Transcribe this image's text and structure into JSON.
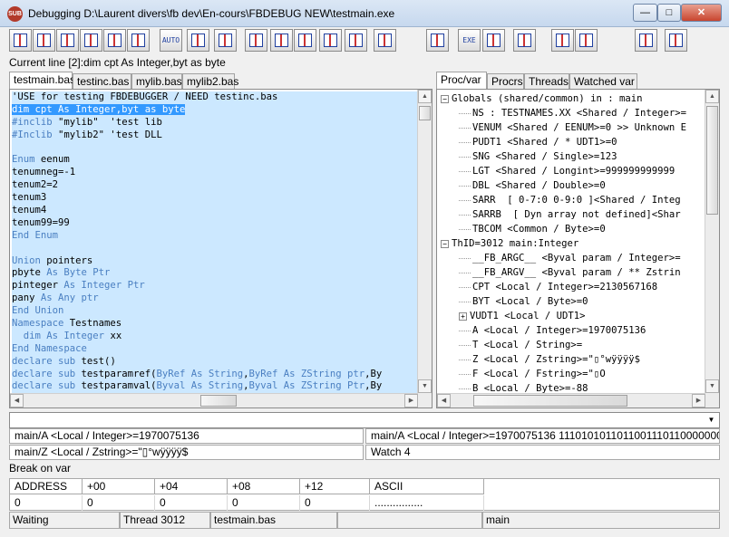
{
  "window": {
    "app_icon_text": "SUB",
    "title": "Debugging D:\\Laurent divers\\fb dev\\En-cours\\FBDEBUG NEW\\testmain.exe",
    "minimize": "—",
    "maximize": "□",
    "close": "✕"
  },
  "toolbar": {
    "buttons": [
      "step",
      "step-over",
      "step-out",
      "run-to-cursor",
      "fast-run",
      "run",
      "auto",
      "run-end",
      "stop-end",
      "kill",
      "breakpoint",
      "breakpoint-temp",
      "skip",
      "show-line",
      "stop",
      "exe-mod",
      "exe",
      "memory",
      "proc",
      "tools",
      "list-a",
      "list-b",
      "list-c"
    ],
    "auto_label": "AUTO",
    "exe_label": "EXE"
  },
  "current_line": "Current line [2]:dim cpt As Integer,byt as byte",
  "source_tabs": [
    "testmain.bas",
    "testinc.bas",
    "mylib.bas",
    "mylib2.bas"
  ],
  "code_lines": [
    [
      {
        "t": "'USE for testing FBDEBUGGER / NEED testinc.bas",
        "c": "n"
      }
    ],
    [
      {
        "t": "dim cpt As Integer,byt as byte",
        "c": "sel"
      }
    ],
    [
      {
        "t": "#inclib",
        "c": "pp"
      },
      {
        "t": " \"mylib\"  'test lib",
        "c": "n"
      }
    ],
    [
      {
        "t": "#Inclib",
        "c": "pp"
      },
      {
        "t": " \"mylib2\" 'test DLL",
        "c": "n"
      }
    ],
    [
      {
        "t": "",
        "c": "n"
      }
    ],
    [
      {
        "t": "Enum",
        "c": "kw"
      },
      {
        "t": " eenum",
        "c": "n"
      }
    ],
    [
      {
        "t": "tenumneg=-1",
        "c": "n"
      }
    ],
    [
      {
        "t": "tenum2=2",
        "c": "n"
      }
    ],
    [
      {
        "t": "tenum3",
        "c": "n"
      }
    ],
    [
      {
        "t": "tenum4",
        "c": "n"
      }
    ],
    [
      {
        "t": "tenum99=99",
        "c": "n"
      }
    ],
    [
      {
        "t": "End Enum",
        "c": "kw"
      }
    ],
    [
      {
        "t": "",
        "c": "n"
      }
    ],
    [
      {
        "t": "Union",
        "c": "kw"
      },
      {
        "t": " pointers",
        "c": "n"
      }
    ],
    [
      {
        "t": "pbyte ",
        "c": "n"
      },
      {
        "t": "As Byte Ptr",
        "c": "kw"
      }
    ],
    [
      {
        "t": "pinteger ",
        "c": "n"
      },
      {
        "t": "As Integer Ptr",
        "c": "kw"
      }
    ],
    [
      {
        "t": "pany ",
        "c": "n"
      },
      {
        "t": "As Any ptr",
        "c": "kw"
      }
    ],
    [
      {
        "t": "End Union",
        "c": "kw"
      }
    ],
    [
      {
        "t": "Namespace",
        "c": "kw"
      },
      {
        "t": " Testnames",
        "c": "n"
      }
    ],
    [
      {
        "t": "  ",
        "c": "n"
      },
      {
        "t": "dim As Integer",
        "c": "kw"
      },
      {
        "t": " xx",
        "c": "n"
      }
    ],
    [
      {
        "t": "End Namespace",
        "c": "kw"
      }
    ],
    [
      {
        "t": "declare sub",
        "c": "kw"
      },
      {
        "t": " test()",
        "c": "n"
      }
    ],
    [
      {
        "t": "declare sub",
        "c": "kw"
      },
      {
        "t": " testparamref(",
        "c": "n"
      },
      {
        "t": "ByRef As String",
        "c": "kw"
      },
      {
        "t": ",",
        "c": "n"
      },
      {
        "t": "ByRef As ZString ptr",
        "c": "kw"
      },
      {
        "t": ",By",
        "c": "n"
      }
    ],
    [
      {
        "t": "declare sub",
        "c": "kw"
      },
      {
        "t": " testparamval(",
        "c": "n"
      },
      {
        "t": "Byval As String",
        "c": "kw"
      },
      {
        "t": ",",
        "c": "n"
      },
      {
        "t": "Byval As ZString Ptr",
        "c": "kw"
      },
      {
        "t": ",By",
        "c": "n"
      }
    ]
  ],
  "var_tabs": [
    "Proc/var",
    "Procrs",
    "Threads",
    "Watched var"
  ],
  "tree": [
    {
      "level": 0,
      "expander": "−",
      "text": "Globals (shared/common) in : main"
    },
    {
      "level": 1,
      "expander": "",
      "text": "NS : TESTNAMES.XX <Shared / Integer>="
    },
    {
      "level": 1,
      "expander": "",
      "text": "VENUM <Shared / EENUM>=0 >> Unknown E"
    },
    {
      "level": 1,
      "expander": "",
      "text": "PUDT1 <Shared / * UDT1>=0"
    },
    {
      "level": 1,
      "expander": "",
      "text": "SNG <Shared / Single>=123"
    },
    {
      "level": 1,
      "expander": "",
      "text": "LGT <Shared / Longint>=999999999999"
    },
    {
      "level": 1,
      "expander": "",
      "text": "DBL <Shared / Double>=0"
    },
    {
      "level": 1,
      "expander": "",
      "text": "SARR  [ 0-7:0 0-9:0 ]<Shared / Integ"
    },
    {
      "level": 1,
      "expander": "",
      "text": "SARRB  [ Dyn array not defined]<Shar"
    },
    {
      "level": 1,
      "expander": "",
      "text": "TBCOM <Common / Byte>=0"
    },
    {
      "level": 0,
      "expander": "−",
      "text": "ThID=3012 main:Integer"
    },
    {
      "level": 1,
      "expander": "",
      "text": "__FB_ARGC__ <Byval param / Integer>="
    },
    {
      "level": 1,
      "expander": "",
      "text": "__FB_ARGV__ <Byval param / ** Zstrin"
    },
    {
      "level": 1,
      "expander": "",
      "text": "CPT <Local / Integer>=2130567168"
    },
    {
      "level": 1,
      "expander": "",
      "text": "BYT <Local / Byte>=0"
    },
    {
      "level": 1,
      "expander": "+",
      "text": "VUDT1 <Local / UDT1>"
    },
    {
      "level": 1,
      "expander": "",
      "text": "A <Local / Integer>=1970075136"
    },
    {
      "level": 1,
      "expander": "",
      "text": "T <Local / String>="
    },
    {
      "level": 1,
      "expander": "",
      "text": "Z <Local / Zstring>=\"▯°wÿÿÿÿ$"
    },
    {
      "level": 1,
      "expander": "",
      "text": "F <Local / Fstring>=\"▯O"
    },
    {
      "level": 1,
      "expander": "",
      "text": "B <Local / Byte>=-88"
    }
  ],
  "watches": [
    "main/A <Local / Integer>=1970075136",
    "main/A <Local / Integer>=1970075136 1110101011011001110110000000000",
    "main/Z <Local / Zstring>=\"▯°wÿÿÿÿ$",
    "Watch 4"
  ],
  "break_label": "Break on var",
  "memory": {
    "headers": [
      "ADDRESS",
      "+00",
      "+04",
      "+08",
      "+12",
      "ASCII"
    ],
    "row": [
      "0",
      "0",
      "0",
      "0",
      "0",
      "................"
    ]
  },
  "status": [
    "Waiting",
    "Thread 3012",
    "testmain.bas",
    "",
    "main"
  ]
}
